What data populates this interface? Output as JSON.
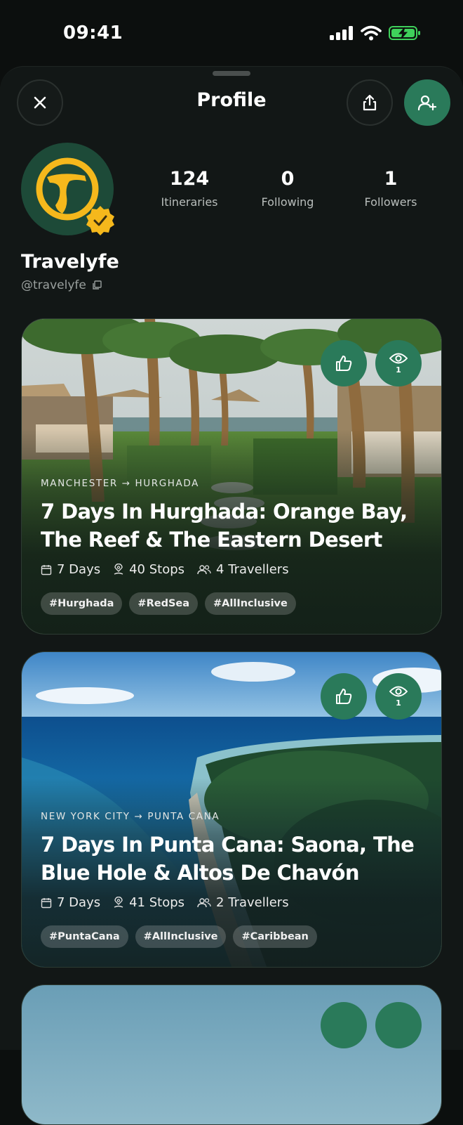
{
  "status": {
    "time": "09:41"
  },
  "sheet": {
    "title": "Profile"
  },
  "profile": {
    "name": "Travelyfe",
    "handle": "@travelyfe",
    "stats": [
      {
        "value": "124",
        "label": "Itineraries"
      },
      {
        "value": "0",
        "label": "Following"
      },
      {
        "value": "1",
        "label": "Followers"
      }
    ]
  },
  "itineraries": [
    {
      "route": "MANCHESTER → HURGHADA",
      "title": "7 Days In Hurghada: Orange Bay, The Reef & The Eastern Desert",
      "days": "7 Days",
      "stops": "40 Stops",
      "travellers": "4 Travellers",
      "views": "1",
      "tags": [
        "#Hurghada",
        "#RedSea",
        "#AllInclusive"
      ]
    },
    {
      "route": "NEW YORK CITY → PUNTA CANA",
      "title": "7 Days In Punta Cana: Saona, The Blue Hole & Altos De Chavón",
      "days": "7 Days",
      "stops": "41 Stops",
      "travellers": "2 Travellers",
      "views": "1",
      "tags": [
        "#PuntaCana",
        "#AllInclusive",
        "#Caribbean"
      ]
    }
  ],
  "colors": {
    "accent": "#2a7a5a",
    "badge": "#f5b81c",
    "background": "#0c0f0e"
  }
}
